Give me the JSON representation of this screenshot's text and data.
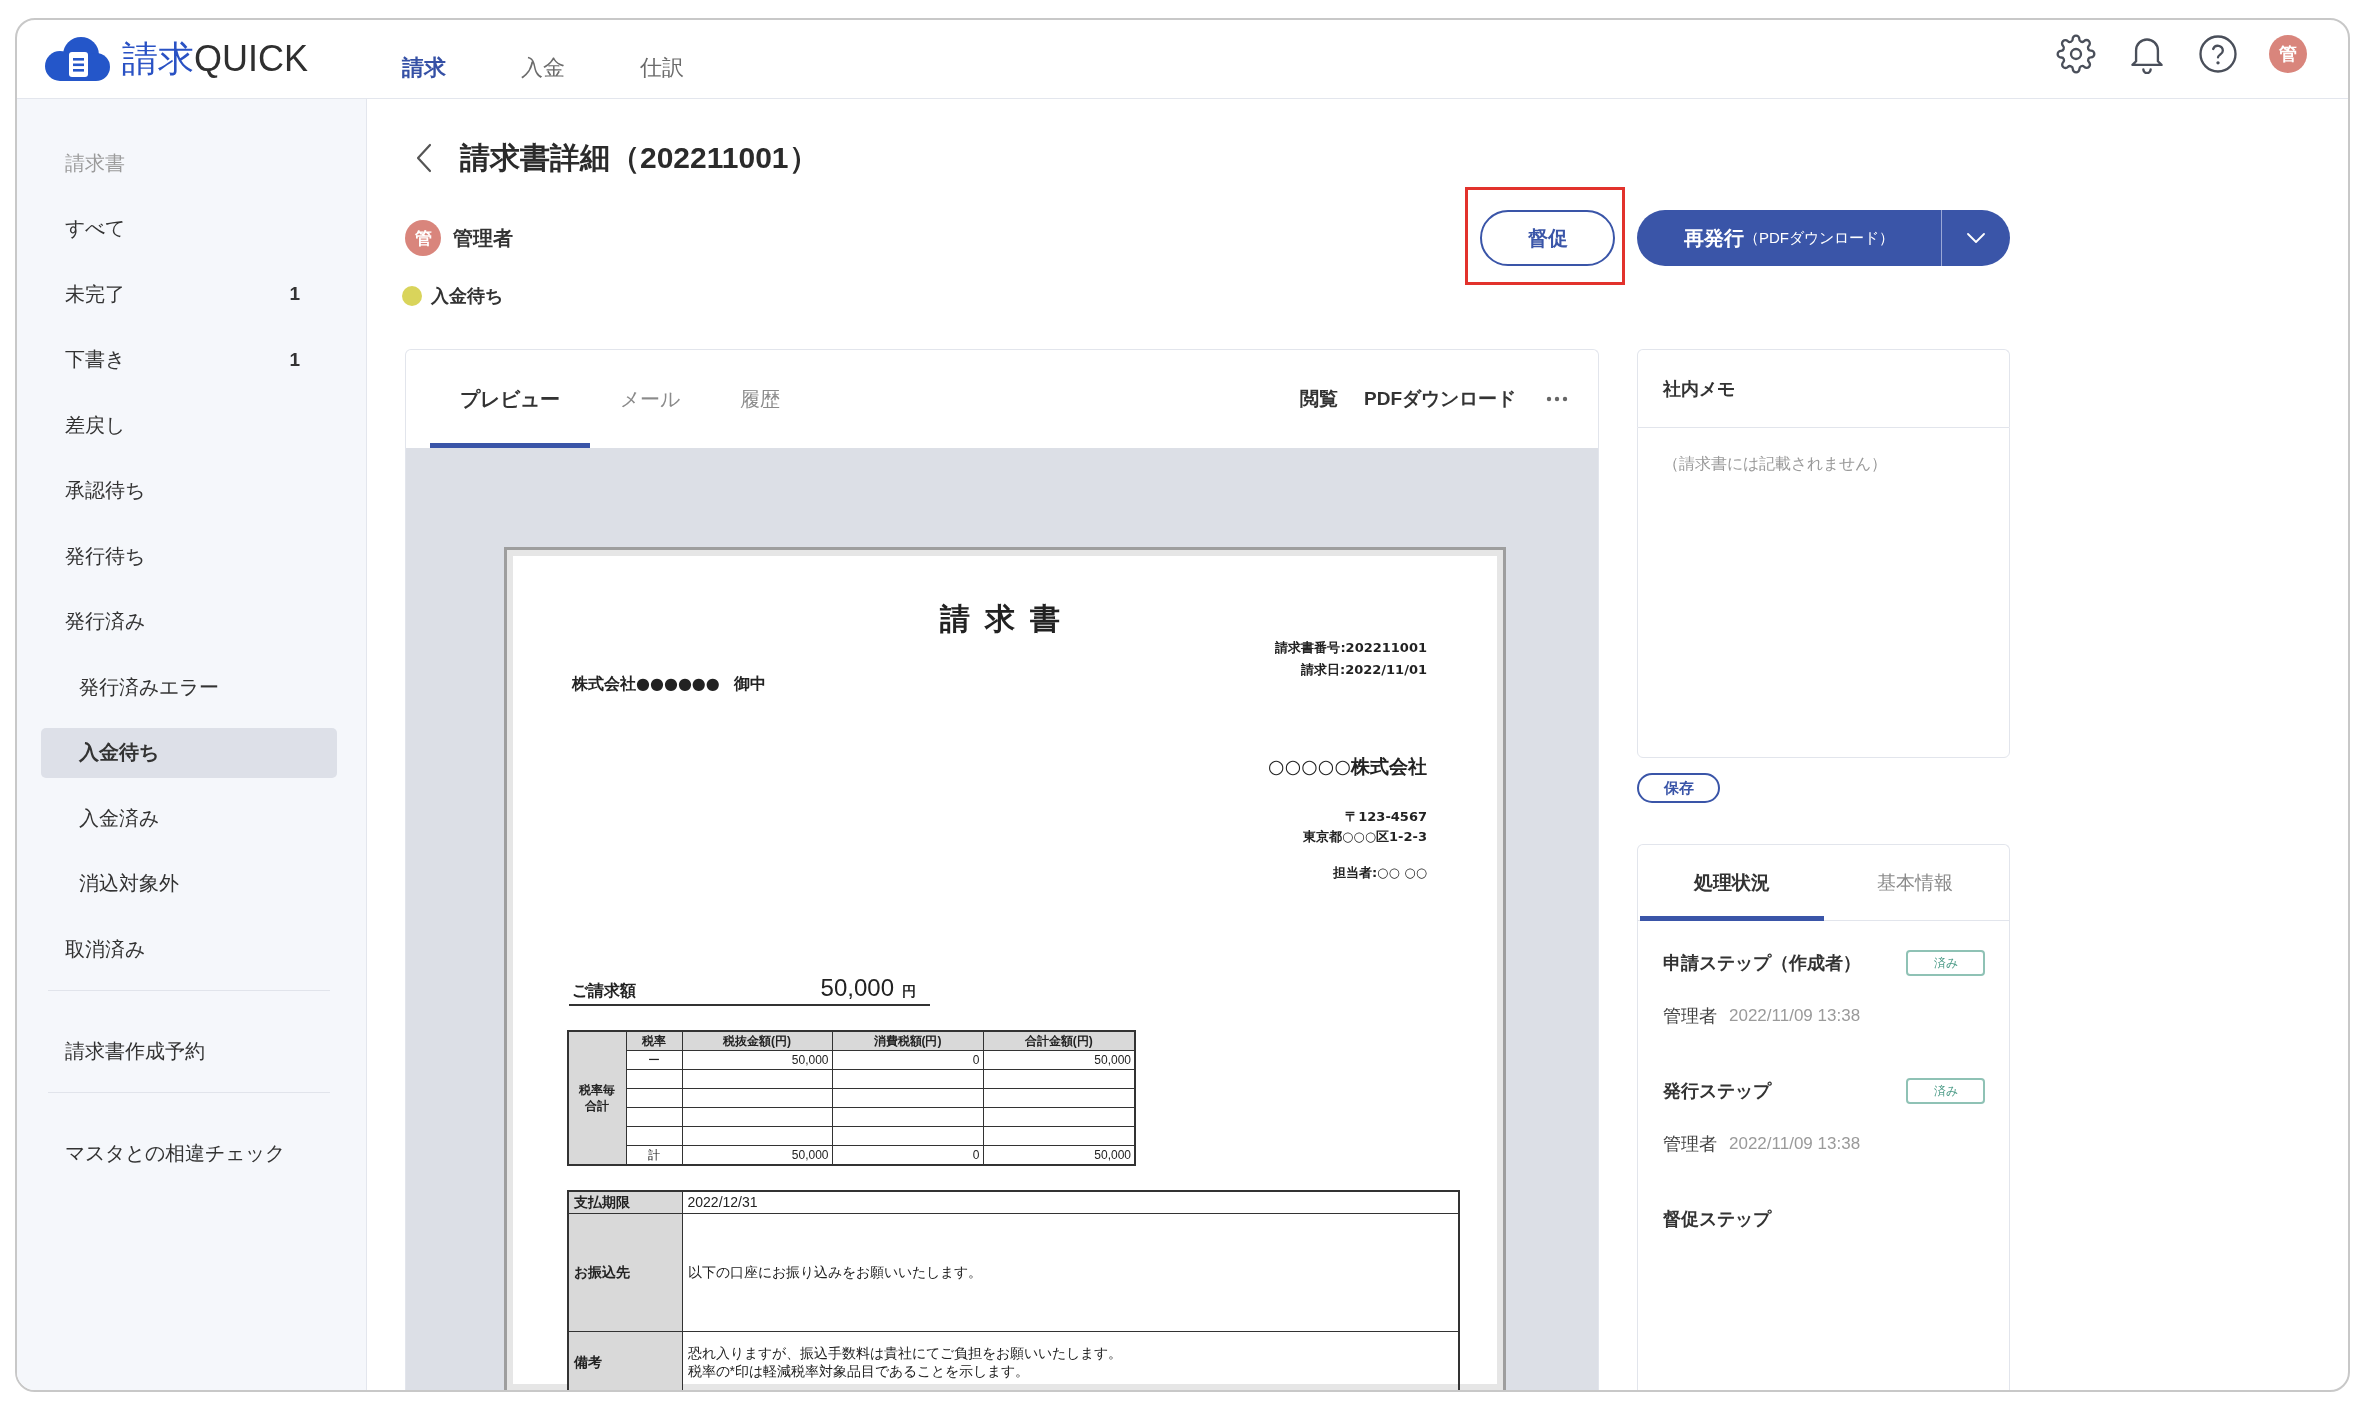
{
  "logo": {
    "mark": "請求",
    "name": "QUICK"
  },
  "nav": [
    {
      "label": "請求",
      "selected": true
    },
    {
      "label": "入金",
      "selected": false
    },
    {
      "label": "仕訳",
      "selected": false
    }
  ],
  "user_avatar": "管",
  "sidebar": {
    "heading": "請求書",
    "sections": [
      {
        "items": [
          {
            "label": "すべて",
            "selected": false
          },
          {
            "label": "未完了",
            "count": "1",
            "selected": false
          },
          {
            "label": "下書き",
            "count": "1",
            "selected": false
          },
          {
            "label": "差戻し",
            "selected": false
          },
          {
            "label": "承認待ち",
            "selected": false
          },
          {
            "label": "発行待ち",
            "selected": false
          },
          {
            "label": "発行済み",
            "selected": false,
            "children": [
              {
                "label": "発行済みエラー",
                "selected": false
              },
              {
                "label": "入金待ち",
                "selected": true
              },
              {
                "label": "入金済み",
                "selected": false
              },
              {
                "label": "消込対象外",
                "selected": false
              }
            ]
          },
          {
            "label": "取消済み",
            "selected": false
          }
        ]
      },
      {
        "items": [
          {
            "label": "請求書作成予約",
            "selected": false
          }
        ]
      },
      {
        "items": [
          {
            "label": "マスタとの相違チェック",
            "selected": false
          }
        ]
      }
    ]
  },
  "page_header": {
    "title": "請求書詳細（202211001）",
    "owner": {
      "avatar": "管",
      "name": "管理者"
    },
    "status": "入金待ち",
    "actions": [
      {
        "kind": "outline",
        "label": "督促",
        "highlighted": true
      },
      {
        "kind": "split",
        "label": "再発行",
        "note": "（PDFダウンロード）",
        "highlighted": false
      }
    ]
  },
  "preview": {
    "tabs": [
      {
        "label": "プレビュー",
        "selected": true
      },
      {
        "label": "メール",
        "selected": false
      },
      {
        "label": "履歴",
        "selected": false
      }
    ],
    "links": [
      "閲覧",
      "PDFダウンロード"
    ],
    "document": {
      "title": "請求書",
      "number": "請求書番号:202211001",
      "date": "請求日:2022/11/01",
      "recipient": "株式会社●●●●●●",
      "honorific": "御中",
      "issuer": "○○○○○株式会社",
      "postal": "〒123-4567",
      "address": "東京都○○○区1-2-3",
      "contact": "担当者:○○ ○○",
      "amount_label": "ご請求額",
      "amount": "50,000",
      "currency": "円",
      "tax_table": {
        "group_label": "税率毎合計",
        "columns": [
          "税率",
          "税抜金額(円)",
          "消費税額(円)",
          "合計金額(円)"
        ],
        "rows": [
          {
            "kind": "data",
            "cells": [
              "ー",
              "50,000",
              "0",
              "50,000"
            ]
          },
          {
            "kind": "blank"
          },
          {
            "kind": "blank"
          },
          {
            "kind": "blank"
          },
          {
            "kind": "blank"
          },
          {
            "kind": "data",
            "cells": [
              "計",
              "50,000",
              "0",
              "50,000"
            ]
          }
        ]
      },
      "terms": [
        {
          "label": "支払期限",
          "lines": [
            "2022/12/31"
          ]
        },
        {
          "label": "お振込先",
          "lines": [
            "以下の口座にお振り込みをお願いいたします。"
          ]
        },
        {
          "label": "備考",
          "lines": [
            "恐れ入りますが、振込手数料は貴社にてご負担をお願いいたします。",
            "税率の*印は軽減税率対象品目であることを示します。"
          ]
        }
      ]
    }
  },
  "memo": {
    "title": "社内メモ",
    "placeholder": "（請求書には記載されません）",
    "save": "保存"
  },
  "progress": {
    "tabs": [
      {
        "label": "処理状況",
        "selected": true
      },
      {
        "label": "基本情報",
        "selected": false
      }
    ],
    "steps": [
      {
        "title": "申請ステップ（作成者）",
        "badge": "済み",
        "user": "管理者",
        "time": "2022/11/09 13:38"
      },
      {
        "title": "発行ステップ",
        "badge": "済み",
        "user": "管理者",
        "time": "2022/11/09 13:38"
      },
      {
        "title": "督促ステップ"
      }
    ]
  }
}
